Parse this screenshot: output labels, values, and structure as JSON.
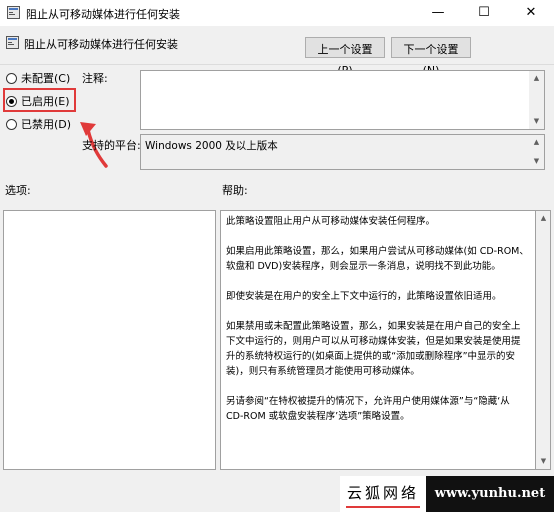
{
  "window": {
    "title": "阻止从可移动媒体进行任何安装",
    "min_label": "—",
    "max_label": "☐",
    "close_label": "✕"
  },
  "header": {
    "title": "阻止从可移动媒体进行任何安装",
    "prev_button": "上一个设置(P)",
    "next_button": "下一个设置(N)"
  },
  "options": {
    "not_configured": "未配置(C)",
    "enabled": "已启用(E)",
    "disabled": "已禁用(D)",
    "selected": "enabled"
  },
  "comment_label": "注释:",
  "platform": {
    "label": "支持的平台:",
    "value": "Windows 2000 及以上版本"
  },
  "options_label": "选项:",
  "help_label": "帮助:",
  "help": {
    "paragraphs": [
      "此策略设置阻止用户从可移动媒体安装任何程序。",
      "如果启用此策略设置，那么，如果用户尝试从可移动媒体(如 CD-ROM、软盘和 DVD)安装程序，则会显示一条消息，说明找不到此功能。",
      "即使安装是在用户的安全上下文中运行的，此策略设置依旧适用。",
      "如果禁用或未配置此策略设置，那么，如果安装是在用户自己的安全上下文中运行的，则用户可以从可移动媒体安装，但是如果安装是使用提升的系统特权运行的(如桌面上提供的或“添加或删除程序”中显示的安装)，则只有系统管理员才能使用可移动媒体。",
      "另请参阅“在特权被提升的情况下，允许用户使用媒体源”与“隐藏‘从 CD-ROM 或软盘安装程序’选项”策略设置。"
    ]
  },
  "watermark": {
    "cn": "云狐网络",
    "url": "www.yunhu.net"
  },
  "colors": {
    "highlight": "#e03a3a",
    "background": "#f0f0f0"
  }
}
